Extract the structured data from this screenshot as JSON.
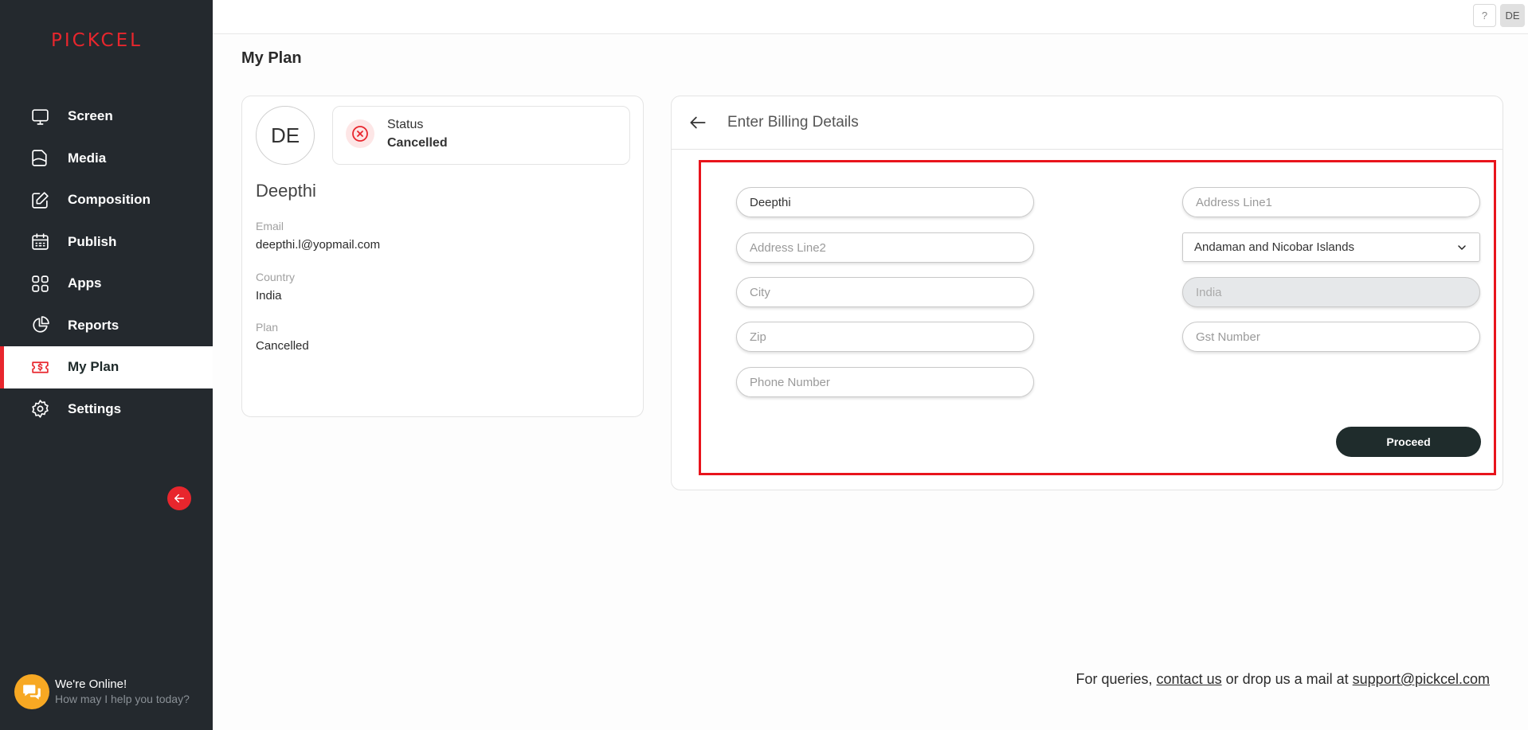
{
  "brand": {
    "logo_text": "PICKCEL"
  },
  "sidebar": {
    "items": [
      {
        "label": "Screen",
        "icon": "monitor-icon"
      },
      {
        "label": "Media",
        "icon": "file-icon"
      },
      {
        "label": "Composition",
        "icon": "edit-icon"
      },
      {
        "label": "Publish",
        "icon": "calendar-icon"
      },
      {
        "label": "Apps",
        "icon": "grid-icon"
      },
      {
        "label": "Reports",
        "icon": "pie-chart-icon"
      },
      {
        "label": "My Plan",
        "icon": "dollar-ticket-icon",
        "active": true
      },
      {
        "label": "Settings",
        "icon": "gear-icon"
      }
    ],
    "chat": {
      "title": "We're Online!",
      "subtitle": "How may I help you today?"
    }
  },
  "topbar": {
    "help_label": "?",
    "user_initials": "DE"
  },
  "page": {
    "title": "My Plan"
  },
  "profile": {
    "initials": "DE",
    "status_label": "Status",
    "status_value": "Cancelled",
    "name": "Deepthi",
    "email_label": "Email",
    "email_value": "deepthi.l@yopmail.com",
    "country_label": "Country",
    "country_value": "India",
    "plan_label": "Plan",
    "plan_value": "Cancelled"
  },
  "billing": {
    "title": "Enter Billing Details",
    "name_value": "Deepthi",
    "address1_placeholder": "Address Line1",
    "address2_placeholder": "Address Line2",
    "state_value": "Andaman and Nicobar Islands",
    "city_placeholder": "City",
    "country_value": "India",
    "zip_placeholder": "Zip",
    "gst_placeholder": "Gst Number",
    "phone_placeholder": "Phone Number",
    "proceed_label": "Proceed"
  },
  "footer": {
    "prefix": "For queries, ",
    "contact_link": "contact us",
    "middle": " or drop us a mail at ",
    "email_link": "support@pickcel.com"
  },
  "colors": {
    "brand_red": "#e8262d",
    "sidebar_bg": "#24292e",
    "button_dark": "#1f2c2c",
    "chat_orange": "#f7a823"
  }
}
